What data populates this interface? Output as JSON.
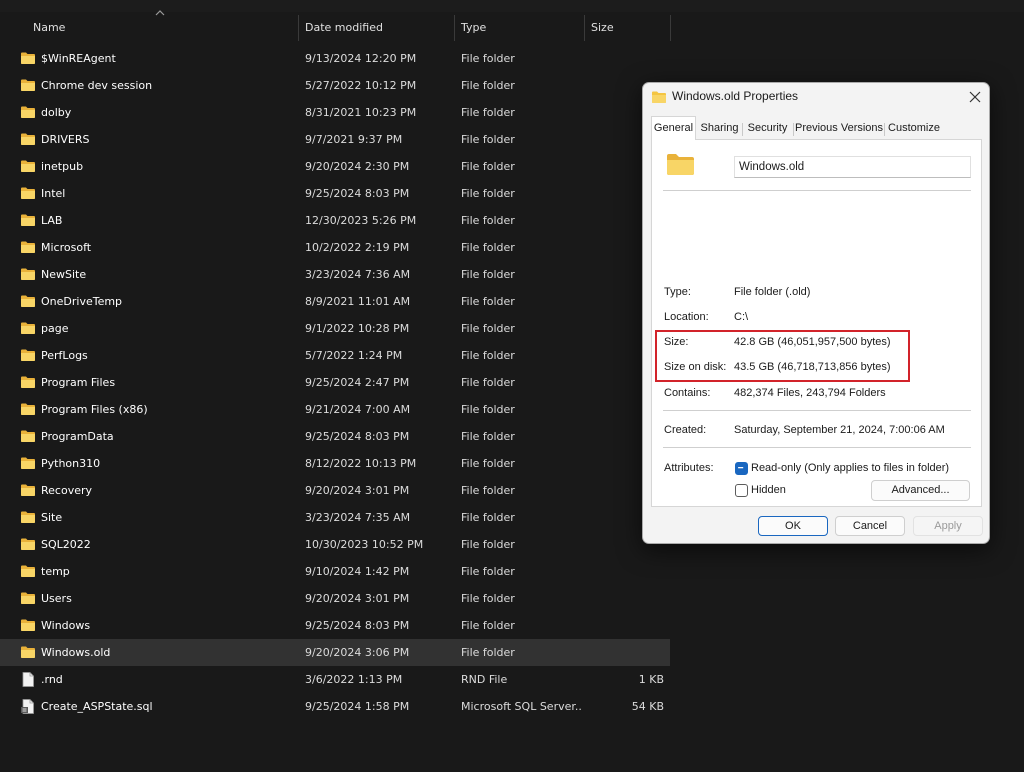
{
  "explorer": {
    "columns": {
      "name": "Name",
      "date": "Date modified",
      "type": "Type",
      "size": "Size"
    },
    "items": [
      {
        "icon": "folder-icon",
        "name": "$WinREAgent",
        "date": "9/13/2024 12:20 PM",
        "type": "File folder",
        "size": ""
      },
      {
        "icon": "folder-icon",
        "name": "Chrome dev session",
        "date": "5/27/2022 10:12 PM",
        "type": "File folder",
        "size": ""
      },
      {
        "icon": "folder-icon",
        "name": "dolby",
        "date": "8/31/2021 10:23 PM",
        "type": "File folder",
        "size": ""
      },
      {
        "icon": "folder-icon",
        "name": "DRIVERS",
        "date": "9/7/2021 9:37 PM",
        "type": "File folder",
        "size": ""
      },
      {
        "icon": "folder-icon",
        "name": "inetpub",
        "date": "9/20/2024 2:30 PM",
        "type": "File folder",
        "size": ""
      },
      {
        "icon": "folder-icon",
        "name": "Intel",
        "date": "9/25/2024 8:03 PM",
        "type": "File folder",
        "size": ""
      },
      {
        "icon": "folder-icon",
        "name": "LAB",
        "date": "12/30/2023 5:26 PM",
        "type": "File folder",
        "size": ""
      },
      {
        "icon": "folder-icon",
        "name": "Microsoft",
        "date": "10/2/2022 2:19 PM",
        "type": "File folder",
        "size": ""
      },
      {
        "icon": "folder-icon",
        "name": "NewSite",
        "date": "3/23/2024 7:36 AM",
        "type": "File folder",
        "size": ""
      },
      {
        "icon": "folder-icon",
        "name": "OneDriveTemp",
        "date": "8/9/2021 11:01 AM",
        "type": "File folder",
        "size": ""
      },
      {
        "icon": "folder-icon",
        "name": "page",
        "date": "9/1/2022 10:28 PM",
        "type": "File folder",
        "size": ""
      },
      {
        "icon": "folder-icon",
        "name": "PerfLogs",
        "date": "5/7/2022 1:24 PM",
        "type": "File folder",
        "size": ""
      },
      {
        "icon": "folder-icon",
        "name": "Program Files",
        "date": "9/25/2024 2:47 PM",
        "type": "File folder",
        "size": ""
      },
      {
        "icon": "folder-icon",
        "name": "Program Files (x86)",
        "date": "9/21/2024 7:00 AM",
        "type": "File folder",
        "size": ""
      },
      {
        "icon": "folder-icon",
        "name": "ProgramData",
        "date": "9/25/2024 8:03 PM",
        "type": "File folder",
        "size": ""
      },
      {
        "icon": "folder-icon",
        "name": "Python310",
        "date": "8/12/2022 10:13 PM",
        "type": "File folder",
        "size": ""
      },
      {
        "icon": "folder-icon",
        "name": "Recovery",
        "date": "9/20/2024 3:01 PM",
        "type": "File folder",
        "size": ""
      },
      {
        "icon": "folder-icon",
        "name": "Site",
        "date": "3/23/2024 7:35 AM",
        "type": "File folder",
        "size": ""
      },
      {
        "icon": "folder-icon",
        "name": "SQL2022",
        "date": "10/30/2023 10:52 PM",
        "type": "File folder",
        "size": ""
      },
      {
        "icon": "folder-icon",
        "name": "temp",
        "date": "9/10/2024 1:42 PM",
        "type": "File folder",
        "size": ""
      },
      {
        "icon": "folder-icon",
        "name": "Users",
        "date": "9/20/2024 3:01 PM",
        "type": "File folder",
        "size": ""
      },
      {
        "icon": "folder-icon",
        "name": "Windows",
        "date": "9/25/2024 8:03 PM",
        "type": "File folder",
        "size": ""
      },
      {
        "icon": "folder-icon",
        "name": "Windows.old",
        "date": "9/20/2024 3:06 PM",
        "type": "File folder",
        "size": "",
        "selected": true
      },
      {
        "icon": "file-icon",
        "name": ".rnd",
        "date": "3/6/2022 1:13 PM",
        "type": "RND File",
        "size": "1 KB"
      },
      {
        "icon": "sql-file-icon",
        "name": "Create_ASPState.sql",
        "date": "9/25/2024 1:58 PM",
        "type": "Microsoft SQL Server...",
        "size": "54 KB"
      }
    ]
  },
  "dialog": {
    "title": "Windows.old Properties",
    "tabs": [
      "General",
      "Sharing",
      "Security",
      "Previous Versions",
      "Customize"
    ],
    "active_tab": "General",
    "folder_name": "Windows.old",
    "props": {
      "type_label": "Type:",
      "type_value": "File folder (.old)",
      "location_label": "Location:",
      "location_value": "C:\\",
      "size_label": "Size:",
      "size_value": "42.8 GB (46,051,957,500 bytes)",
      "size_on_disk_label": "Size on disk:",
      "size_on_disk_value": "43.5 GB (46,718,713,856 bytes)",
      "contains_label": "Contains:",
      "contains_value": "482,374 Files, 243,794 Folders",
      "created_label": "Created:",
      "created_value": "Saturday, September 21, 2024, 7:00:06 AM",
      "attributes_label": "Attributes:"
    },
    "readonly_label": "Read-only (Only applies to files in folder)",
    "readonly_checked": true,
    "hidden_label": "Hidden",
    "hidden_checked": false,
    "advanced_label": "Advanced...",
    "buttons": {
      "ok": "OK",
      "cancel": "Cancel",
      "apply": "Apply"
    },
    "highlight_color": "#d2232a"
  },
  "colors": {
    "background": "#191919",
    "selected_row": "#323232",
    "folder": "#f4c542",
    "accent": "#1a67c0"
  }
}
